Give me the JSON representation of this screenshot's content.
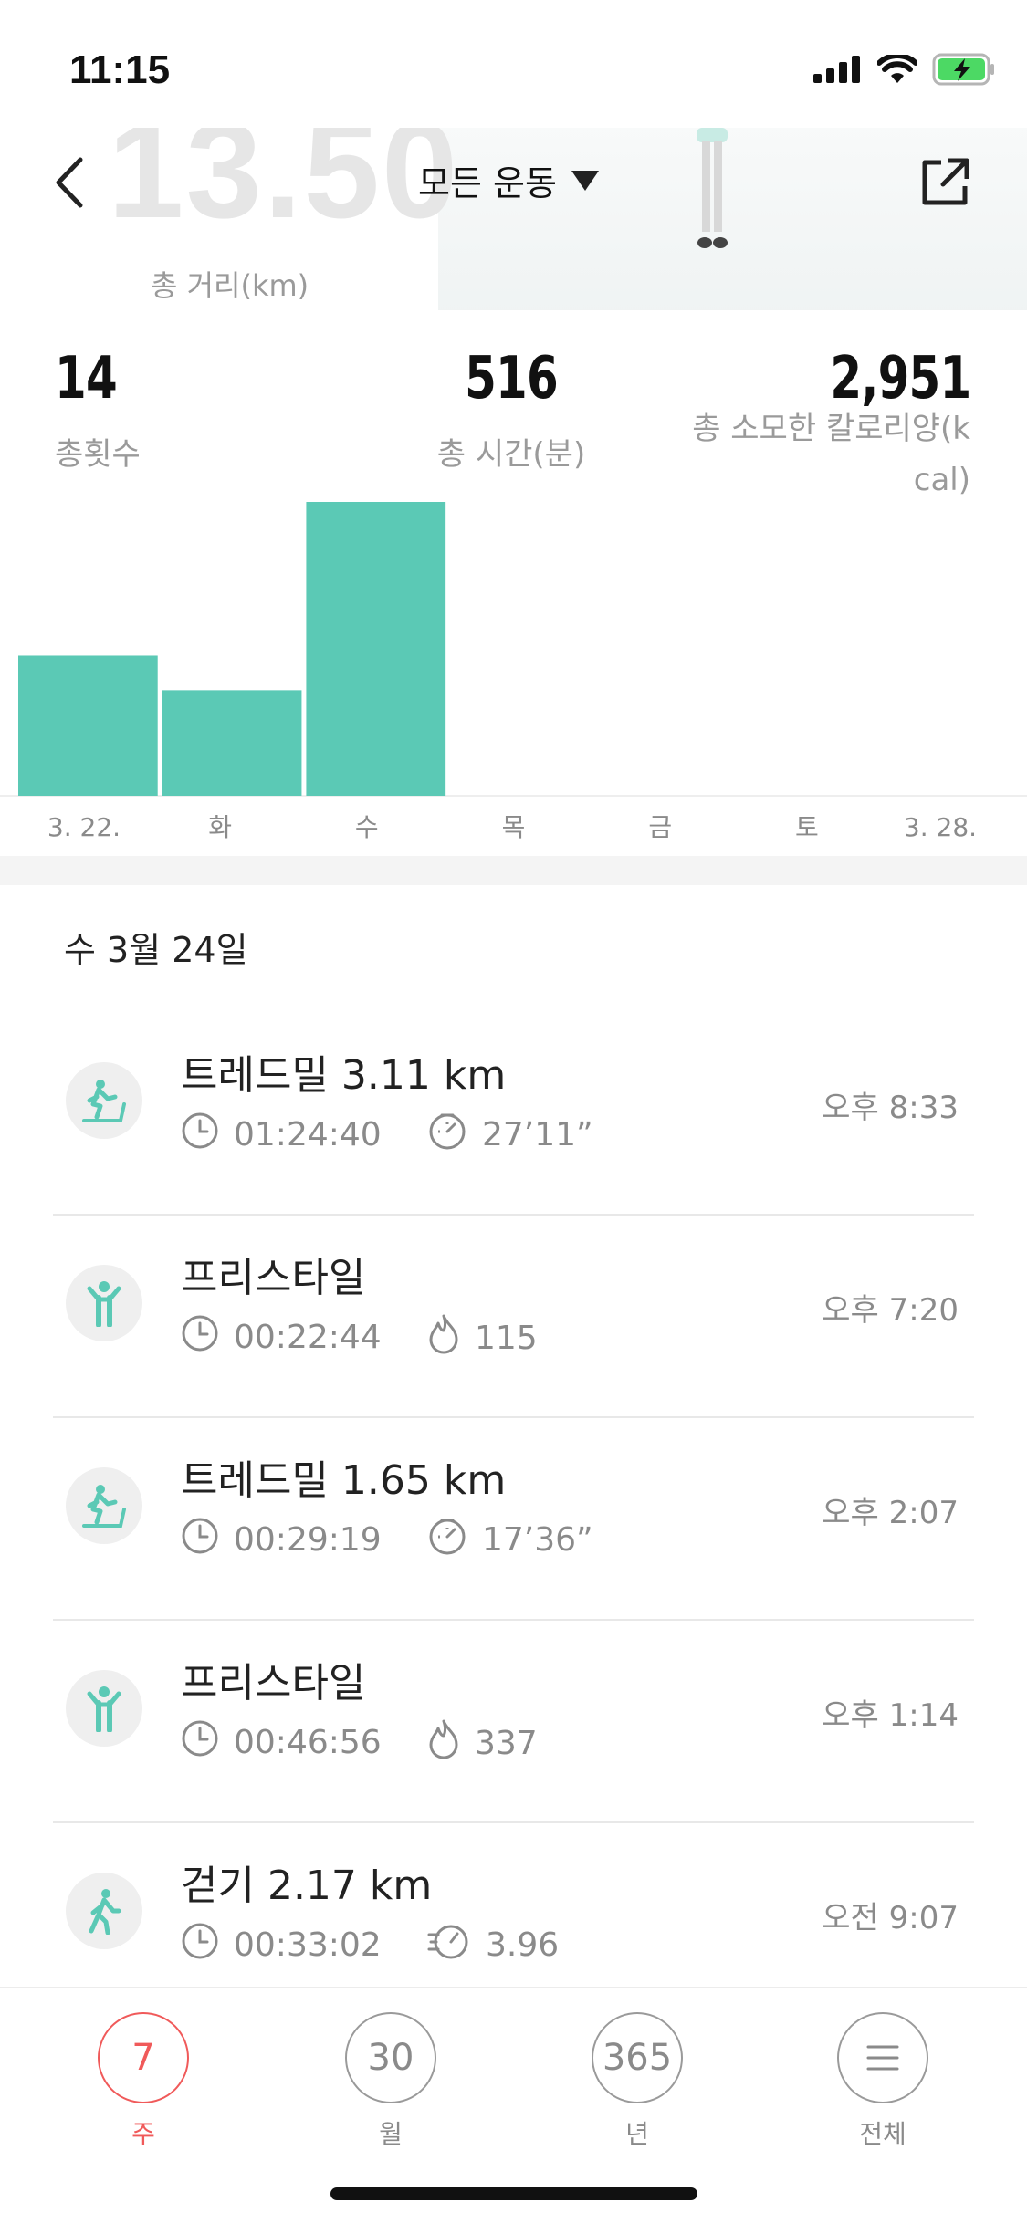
{
  "status_bar": {
    "time": "11:15"
  },
  "header": {
    "big_distance": "13.50",
    "distance_label": "총 거리(km)",
    "filter_label": "모든 운동"
  },
  "stats": [
    {
      "value": "14",
      "label": "총횟수"
    },
    {
      "value": "516",
      "label": "총 시간(분)"
    },
    {
      "value": "2,951",
      "label_line1": "총 소모한 칼로리양(k",
      "label_line2": "cal)"
    }
  ],
  "chart_data": {
    "type": "bar",
    "categories": [
      "3. 22.",
      "화",
      "수",
      "목",
      "금",
      "토",
      "3. 28."
    ],
    "values": [
      154,
      116,
      323,
      0,
      0,
      0,
      0
    ],
    "color": "#5bc9b5"
  },
  "date_header": "수 3월 24일",
  "workouts": [
    {
      "title": "트레드밀 3.11 km",
      "duration": "01:24:40",
      "metric2": "27’11”",
      "metric2_icon": "pace-icon",
      "time": "오후 8:33",
      "icon": "treadmill-icon"
    },
    {
      "title": "프리스타일",
      "duration": "00:22:44",
      "metric2": "115",
      "metric2_icon": "flame-icon",
      "time": "오후 7:20",
      "icon": "freestyle-icon"
    },
    {
      "title": "트레드밀 1.65 km",
      "duration": "00:29:19",
      "metric2": "17’36”",
      "metric2_icon": "pace-icon",
      "time": "오후 2:07",
      "icon": "treadmill-icon"
    },
    {
      "title": "프리스타일",
      "duration": "00:46:56",
      "metric2": "337",
      "metric2_icon": "flame-icon",
      "time": "오후 1:14",
      "icon": "freestyle-icon"
    },
    {
      "title": "걷기 2.17 km",
      "duration": "00:33:02",
      "metric2": "3.96",
      "metric2_icon": "speed-icon",
      "time": "오전 9:07",
      "icon": "walking-icon"
    }
  ],
  "tabs": [
    {
      "number": "7",
      "label": "주",
      "active": true
    },
    {
      "number": "30",
      "label": "월",
      "active": false
    },
    {
      "number": "365",
      "label": "년",
      "active": false
    },
    {
      "number": "",
      "label": "전체",
      "active": false
    }
  ],
  "colors": {
    "accent": "#5bc9b5",
    "active_tab": "#f05a5a"
  }
}
